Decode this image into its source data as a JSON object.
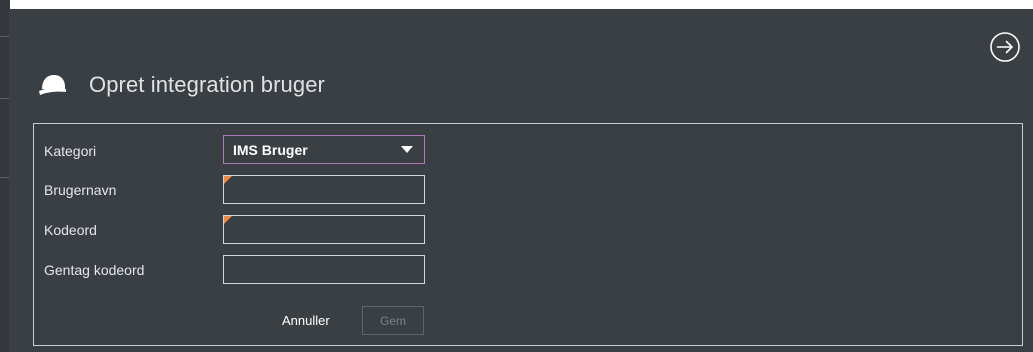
{
  "dialog": {
    "title": "Opret integration bruger"
  },
  "form": {
    "category": {
      "label": "Kategori",
      "selected": "IMS Bruger"
    },
    "username": {
      "label": "Brugernavn",
      "value": "",
      "required": true
    },
    "password": {
      "label": "Kodeord",
      "value": "",
      "required": true
    },
    "repeat_password": {
      "label": "Gentag kodeord",
      "value": ""
    }
  },
  "actions": {
    "cancel_label": "Annuller",
    "save_label": "Gem"
  },
  "icons": {
    "header": "cap-icon",
    "exit": "arrow-right-circle-icon"
  },
  "colors": {
    "background": "#3a3f44",
    "text": "#e4e7ea",
    "required_marker": "#f08a3c",
    "select_border": "#b07ab8",
    "disabled_text": "#7c8288"
  }
}
